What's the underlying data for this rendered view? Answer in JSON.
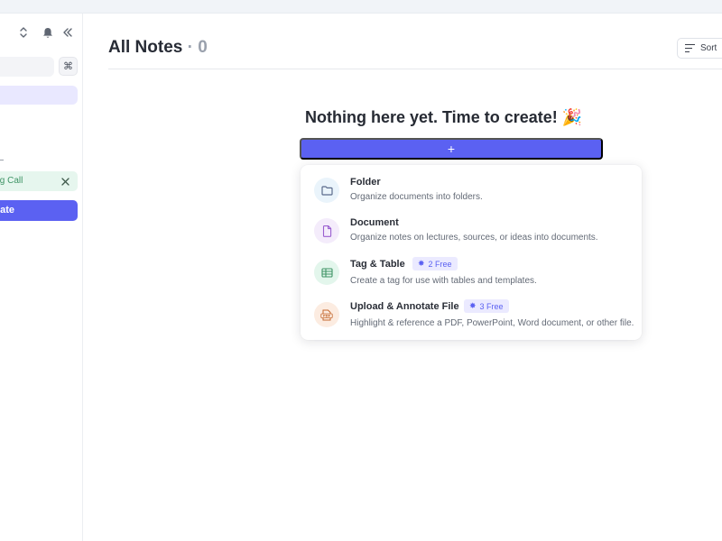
{
  "sidebar": {
    "chip_label": "ing Call",
    "create_label": "eate",
    "cmd_symbol": "⌘"
  },
  "header": {
    "title": "All Notes",
    "separator": "·",
    "count": "0",
    "sort_label": "Sort"
  },
  "empty_state": {
    "title": "Nothing here yet. Time to create! 🎉",
    "add_symbol": "+"
  },
  "create_menu": {
    "items": [
      {
        "title": "Folder",
        "description": "Organize documents into folders.",
        "icon": "folder-icon",
        "color": "#5b6b8c",
        "bg": "#eaf4fb"
      },
      {
        "title": "Document",
        "description": "Organize notes on lectures, sources, or ideas into documents.",
        "icon": "document-icon",
        "color": "#9a5fd0",
        "bg": "#f4ecfb"
      },
      {
        "title": "Tag & Table",
        "description": "Create a tag for use with tables and templates.",
        "icon": "table-icon",
        "color": "#3f9466",
        "bg": "#e3f6ec",
        "badge": "2 Free"
      },
      {
        "title": "Upload & Annotate File",
        "description": "Highlight & reference a PDF, PowerPoint, Word document, or other file.",
        "icon": "pdf-file-icon",
        "color": "#c4682f",
        "bg": "#fcece1",
        "badge": "3 Free"
      }
    ]
  },
  "colors": {
    "accent": "#5b61f2",
    "accent_soft": "#ebeaff",
    "success_soft": "#e6f6ee"
  }
}
